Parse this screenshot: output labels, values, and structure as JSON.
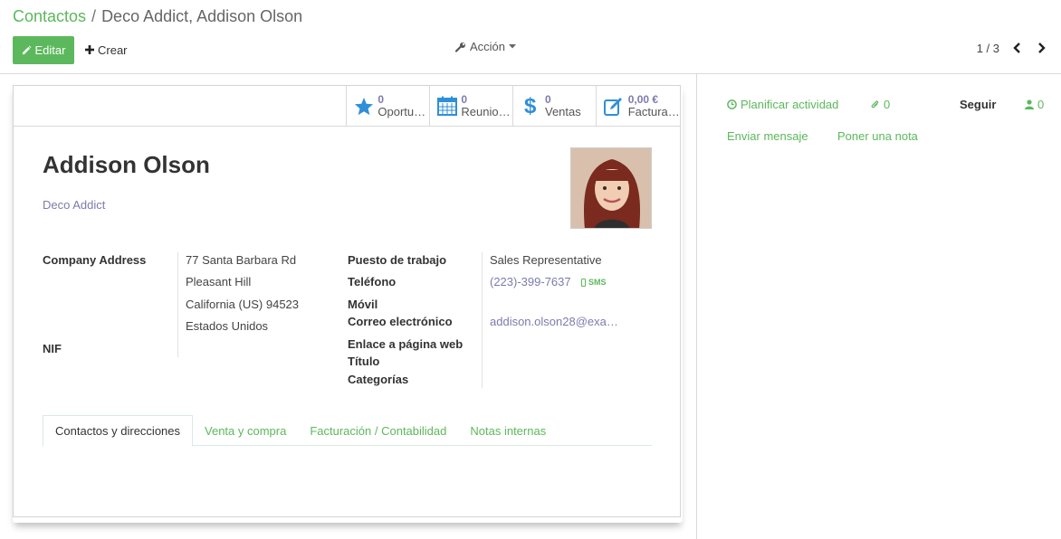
{
  "breadcrumb": {
    "parent": "Contactos",
    "current": "Deco Addict, Addison Olson"
  },
  "toolbar": {
    "edit_label": "Editar",
    "create_label": "Crear",
    "action_label": "Acción"
  },
  "pager": {
    "text": "1 / 3"
  },
  "stat_buttons": [
    {
      "value": "0",
      "label": "Oportunidades",
      "icon": "star-icon"
    },
    {
      "value": "0",
      "label": "Reuniones",
      "icon": "calendar-icon"
    },
    {
      "value": "0",
      "label": "Ventas",
      "icon": "dollar-icon"
    },
    {
      "value": "0,00 €",
      "label": "Facturado",
      "icon": "invoice-icon"
    }
  ],
  "partner": {
    "name": "Addison Olson",
    "company": "Deco Addict",
    "address_label": "Company Address",
    "street": "77 Santa Barbara Rd",
    "city": "Pleasant Hill",
    "state_zip": "California (US) 94523",
    "country": "Estados Unidos",
    "vat_label": "NIF",
    "job_label": "Puesto de trabajo",
    "job_value": "Sales Representative",
    "phone_label": "Teléfono",
    "phone_value": "(223)-399-7637",
    "sms_label": "SMS",
    "mobile_label": "Móvil",
    "email_label": "Correo electrónico",
    "email_value": "addison.olson28@exa…",
    "website_label": "Enlace a página web",
    "title_label": "Título",
    "tags_label": "Categorías"
  },
  "tabs": [
    {
      "label": "Contactos y direcciones",
      "active": true
    },
    {
      "label": "Venta y compra",
      "active": false
    },
    {
      "label": "Facturación / Contabilidad",
      "active": false
    },
    {
      "label": "Notas internas",
      "active": false
    }
  ],
  "chatter": {
    "plan_activity": "Planificar actividad",
    "attachments": "0",
    "follow": "Seguir",
    "followers": "0",
    "send_message": "Enviar mensaje",
    "log_note": "Poner una nota"
  },
  "colors": {
    "primary": "#5cb85c",
    "link": "#7c7bad",
    "star": "#2f8fd8"
  }
}
